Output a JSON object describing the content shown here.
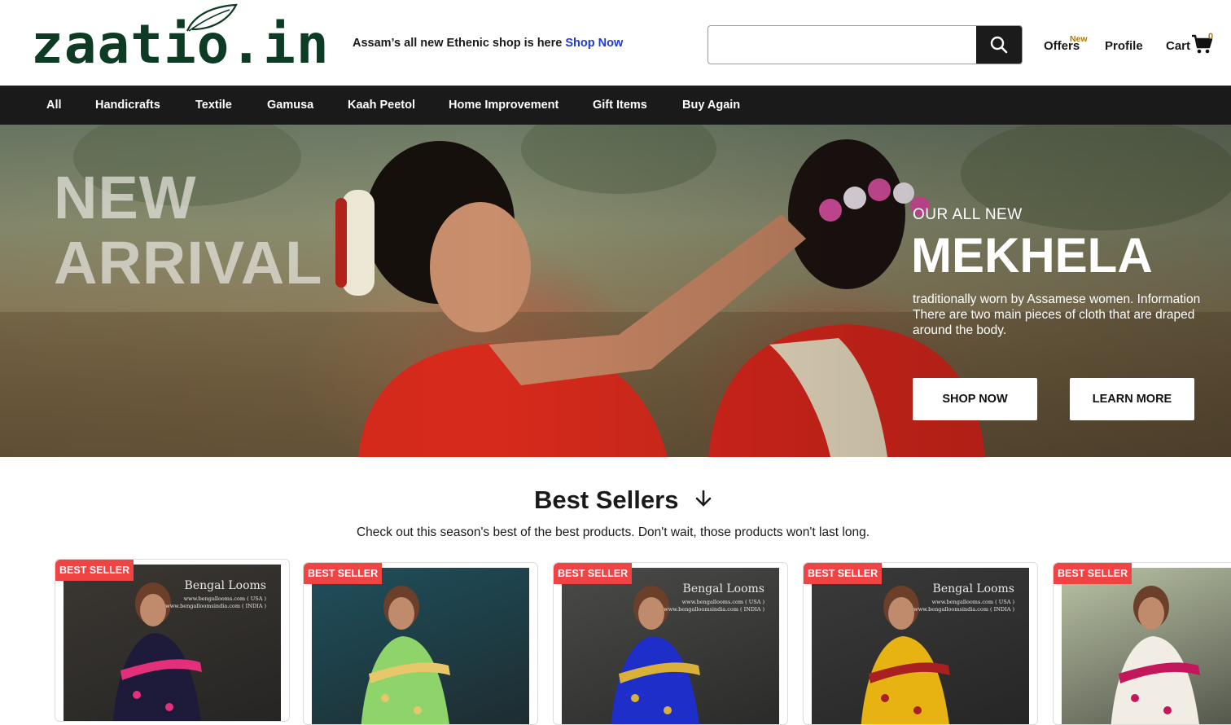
{
  "header": {
    "logo_text": "zaatio.in",
    "promo_text": "Assam’s all new Ethenic shop is here",
    "promo_link": "Shop Now",
    "search": {
      "value": "",
      "placeholder": ""
    },
    "offers_label": "Offers",
    "offers_badge": "New",
    "profile_label": "Profile",
    "cart_label": "Cart",
    "cart_count": "0"
  },
  "categories": [
    "All",
    "Handicrafts",
    "Textile",
    "Gamusa",
    "Kaah Peetol",
    "Home Improvement",
    "Gift Items",
    "Buy Again"
  ],
  "hero": {
    "title_line1": "NEW",
    "title_line2": "ARRIVAL",
    "kicker": "OUR ALL NEW",
    "heading": "MEKHELA",
    "description": "traditionally worn by Assamese women. Information There are two main pieces of cloth that are draped around the body.",
    "shop_button": "SHOP NOW",
    "learn_button": "LEARN MORE"
  },
  "best_sellers": {
    "title": "Best Sellers",
    "subtitle": "Check out this season's best of the best products. Don't wait, those products won't last long.",
    "products": [
      {
        "badge": "BEST SELLER",
        "brand": "Bengal Looms",
        "url1": "www.bengallooms.com ( USA )",
        "url2": "www.bengalloomsindia.com ( INDIA )",
        "bg": "#3b3732",
        "saree": "#1e1a3a",
        "accent": "#e4307a"
      },
      {
        "badge": "BEST SELLER",
        "brand": "",
        "url1": "",
        "url2": "",
        "bg": "#1f4f5c",
        "saree": "#8fd46a",
        "accent": "#e7c76a"
      },
      {
        "badge": "BEST SELLER",
        "brand": "Bengal Looms",
        "url1": "www.bengallooms.com ( USA )",
        "url2": "www.bengalloomsindia.com ( INDIA )",
        "bg": "#4a4a48",
        "saree": "#1e2fc9",
        "accent": "#d9b13a"
      },
      {
        "badge": "BEST SELLER",
        "brand": "Bengal Looms",
        "url1": "www.bengallooms.com ( USA )",
        "url2": "www.bengalloomsindia.com ( INDIA )",
        "bg": "#3a3a3a",
        "saree": "#e7b313",
        "accent": "#a82020"
      },
      {
        "badge": "BEST SELLER",
        "brand": "",
        "url1": "",
        "url2": "",
        "bg": "#b9c2a4",
        "saree": "#f1ede4",
        "accent": "#c2185b"
      }
    ]
  },
  "colors": {
    "brand_green": "#0d3b23",
    "nav_bg": "#1a1a1a",
    "link_blue": "#1d3bd8",
    "badge_red": "#ef4444",
    "new_gold": "#a87a10"
  },
  "icons": {
    "search": "search-icon",
    "cart": "cart-icon",
    "arrow": "arrow-down-icon",
    "leaf": "leaf-icon"
  }
}
